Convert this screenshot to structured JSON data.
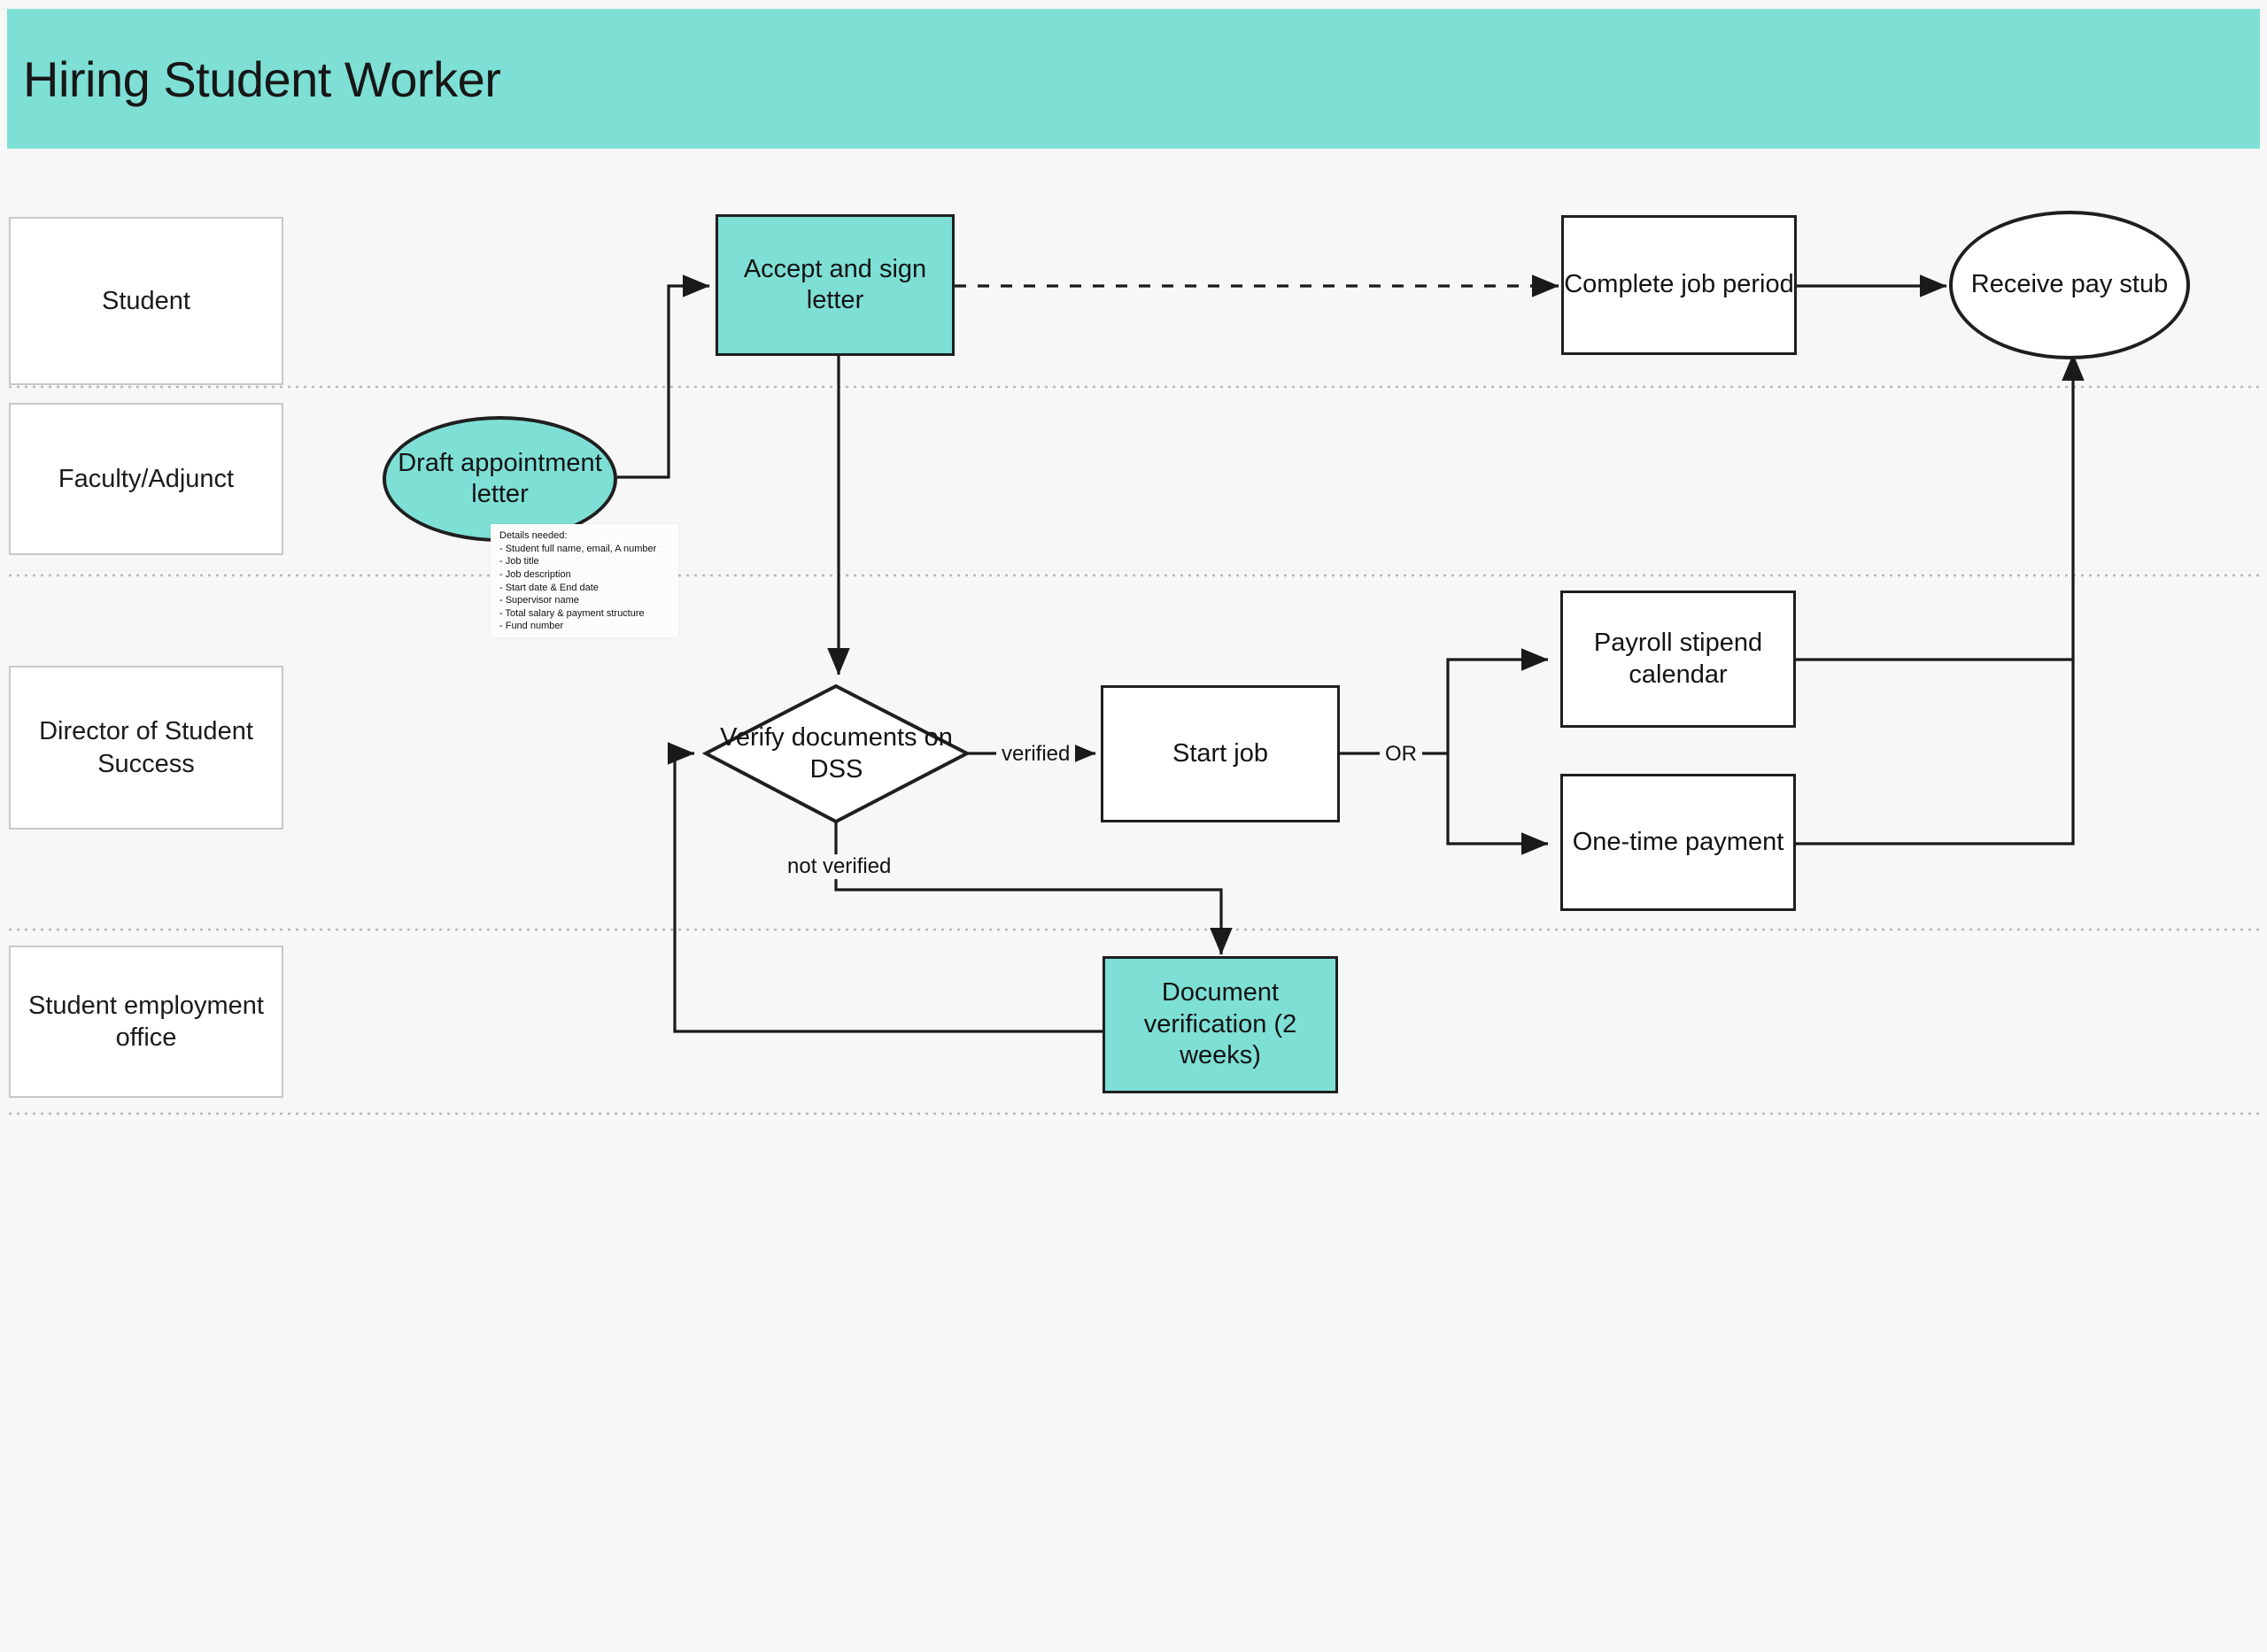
{
  "header": {
    "title": "Hiring Student Worker",
    "banner_color": "#7edfd5"
  },
  "lanes": [
    {
      "label": "Student"
    },
    {
      "label": "Faculty/Adjunct"
    },
    {
      "label": "Director of Student Success"
    },
    {
      "label": "Student employment office"
    }
  ],
  "nodes": {
    "accept_sign_letter": {
      "label": "Accept and sign letter",
      "shape": "rectangle",
      "fill": "#7edfd5"
    },
    "complete_job_period": {
      "label": "Complete job period",
      "shape": "rectangle",
      "fill": "#ffffff"
    },
    "receive_pay_stub": {
      "label": "Receive pay stub",
      "shape": "ellipse",
      "fill": "#ffffff"
    },
    "draft_appointment_letter": {
      "label": "Draft appointment letter",
      "shape": "ellipse",
      "fill": "#7edfd5"
    },
    "verify_documents": {
      "label": "Verify documents on DSS",
      "shape": "diamond",
      "fill": "#ffffff"
    },
    "start_job": {
      "label": "Start job",
      "shape": "rectangle",
      "fill": "#ffffff"
    },
    "payroll_stipend_calendar": {
      "label": "Payroll stipend calendar",
      "shape": "rectangle",
      "fill": "#ffffff"
    },
    "one_time_payment": {
      "label": "One-time payment",
      "shape": "rectangle",
      "fill": "#ffffff"
    },
    "document_verification": {
      "label": "Document verification (2 weeks)",
      "shape": "rectangle",
      "fill": "#7edfd5"
    }
  },
  "edge_labels": {
    "verified": "verified",
    "not_verified": "not verified",
    "or": "OR"
  },
  "note": {
    "heading": "Details needed:",
    "items": [
      "- Student full name, email, A number",
      "- Job title",
      "- Job description",
      "- Start date & End date",
      "- Supervisor name",
      "- Total salary & payment structure",
      "- Fund number"
    ]
  }
}
